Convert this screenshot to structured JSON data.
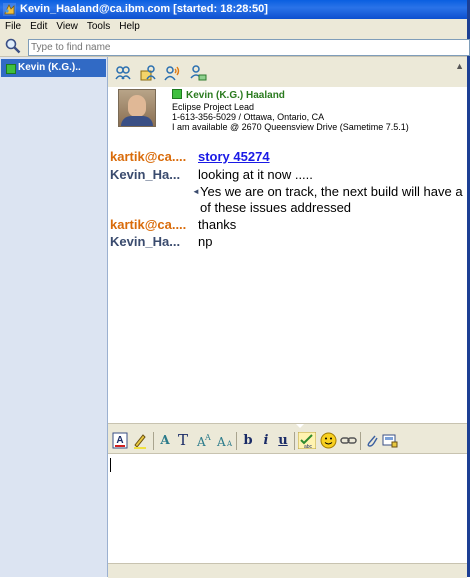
{
  "window": {
    "title": "Kevin_Haaland@ca.ibm.com [started: 18:28:50]"
  },
  "menu": [
    "File",
    "Edit",
    "View",
    "Tools",
    "Help"
  ],
  "search": {
    "placeholder": "Type to find name"
  },
  "sidebar": {
    "items": [
      {
        "label": "Kevin (K.G.)..",
        "status": "online"
      }
    ]
  },
  "toolbar": {
    "icons": [
      "add-participants-icon",
      "send-file-icon",
      "voice-call-icon",
      "share-screen-icon"
    ]
  },
  "profile": {
    "name": "Kevin (K.G.) Haaland",
    "title": "Eclipse Project Lead",
    "phone_location": "1-613-356-5029 / Ottawa, Ontario, CA",
    "availability": "I am available @ 2670 Queensview Drive (Sametime 7.5.1)"
  },
  "transcript": [
    {
      "sender": "kartik@ca....",
      "type": "link",
      "text": "story 45274"
    },
    {
      "sender": "Kevin_Ha...",
      "type": "text",
      "text": "looking at it now ....."
    },
    {
      "sender": "",
      "type": "continuation",
      "text": "Yes we are on track, the next build will have a"
    },
    {
      "sender": "",
      "type": "continuation",
      "text": "of these issues addressed"
    },
    {
      "sender": "kartik@ca....",
      "type": "text",
      "text": "thanks"
    },
    {
      "sender": "Kevin_Ha...",
      "type": "text",
      "text": "np"
    }
  ],
  "format_toolbar": {
    "labels": {
      "font": "A",
      "text_size": "T",
      "bold": "b",
      "italic": "i",
      "underline": "u"
    },
    "icons": [
      "font-color-icon",
      "highlight-icon",
      "font-face-icon",
      "text-size-icon",
      "grow-font-icon",
      "shrink-font-icon",
      "bold-icon",
      "italic-icon",
      "underline-icon",
      "spell-check-icon",
      "emoticon-icon",
      "insert-link-icon",
      "attach-icon",
      "screen-capture-icon"
    ]
  },
  "colors": {
    "title_bar": "#0a5fe0",
    "selected_contact": "#316ac5",
    "sender_kartik": "#d96b0a",
    "sender_kevin": "#3a4b6e",
    "link": "#1a1ae6"
  }
}
